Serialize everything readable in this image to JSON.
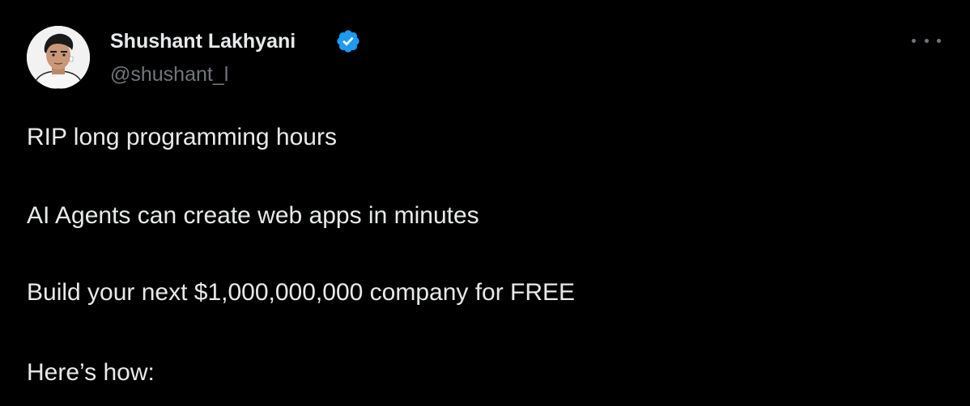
{
  "author": {
    "display_name": "Shushant Lakhyani",
    "handle": "@shushant_l",
    "verified": true,
    "verified_color": "#1d9bf0"
  },
  "tweet": {
    "lines": [
      "RIP long programming hours",
      "AI Agents can create web apps in minutes",
      "Build your next $1,000,000,000 company for FREE",
      "Here’s how:"
    ]
  },
  "icons": {
    "more": "more-options-icon",
    "verified": "verified-badge-icon"
  },
  "colors": {
    "background": "#000000",
    "text_primary": "#e7e9ea",
    "text_secondary": "#71767b"
  }
}
